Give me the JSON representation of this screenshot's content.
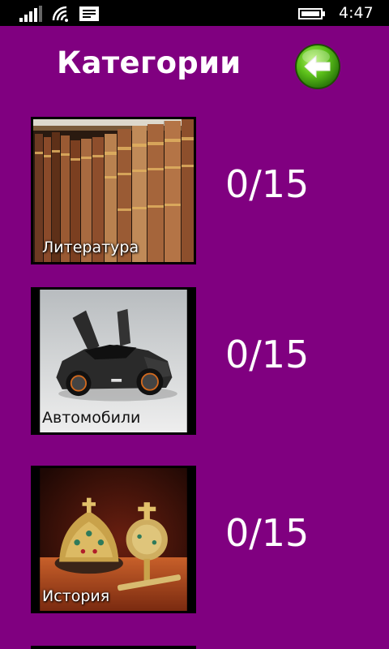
{
  "status_bar": {
    "time": "4:47",
    "icons": [
      "signal-icon",
      "wifi-icon",
      "message-icon",
      "battery-icon"
    ]
  },
  "header": {
    "title": "Категории",
    "back_icon": "back-arrow-icon"
  },
  "categories": [
    {
      "label": "Литература",
      "score": "0/15",
      "image": "bookshelf"
    },
    {
      "label": "Автомобили",
      "score": "0/15",
      "image": "sports-car"
    },
    {
      "label": "История",
      "score": "0/15",
      "image": "crown-and-scepter"
    }
  ],
  "colors": {
    "background": "#800080",
    "status_bar": "#000000",
    "text": "#ffffff",
    "back_button": "#5cc01a"
  }
}
